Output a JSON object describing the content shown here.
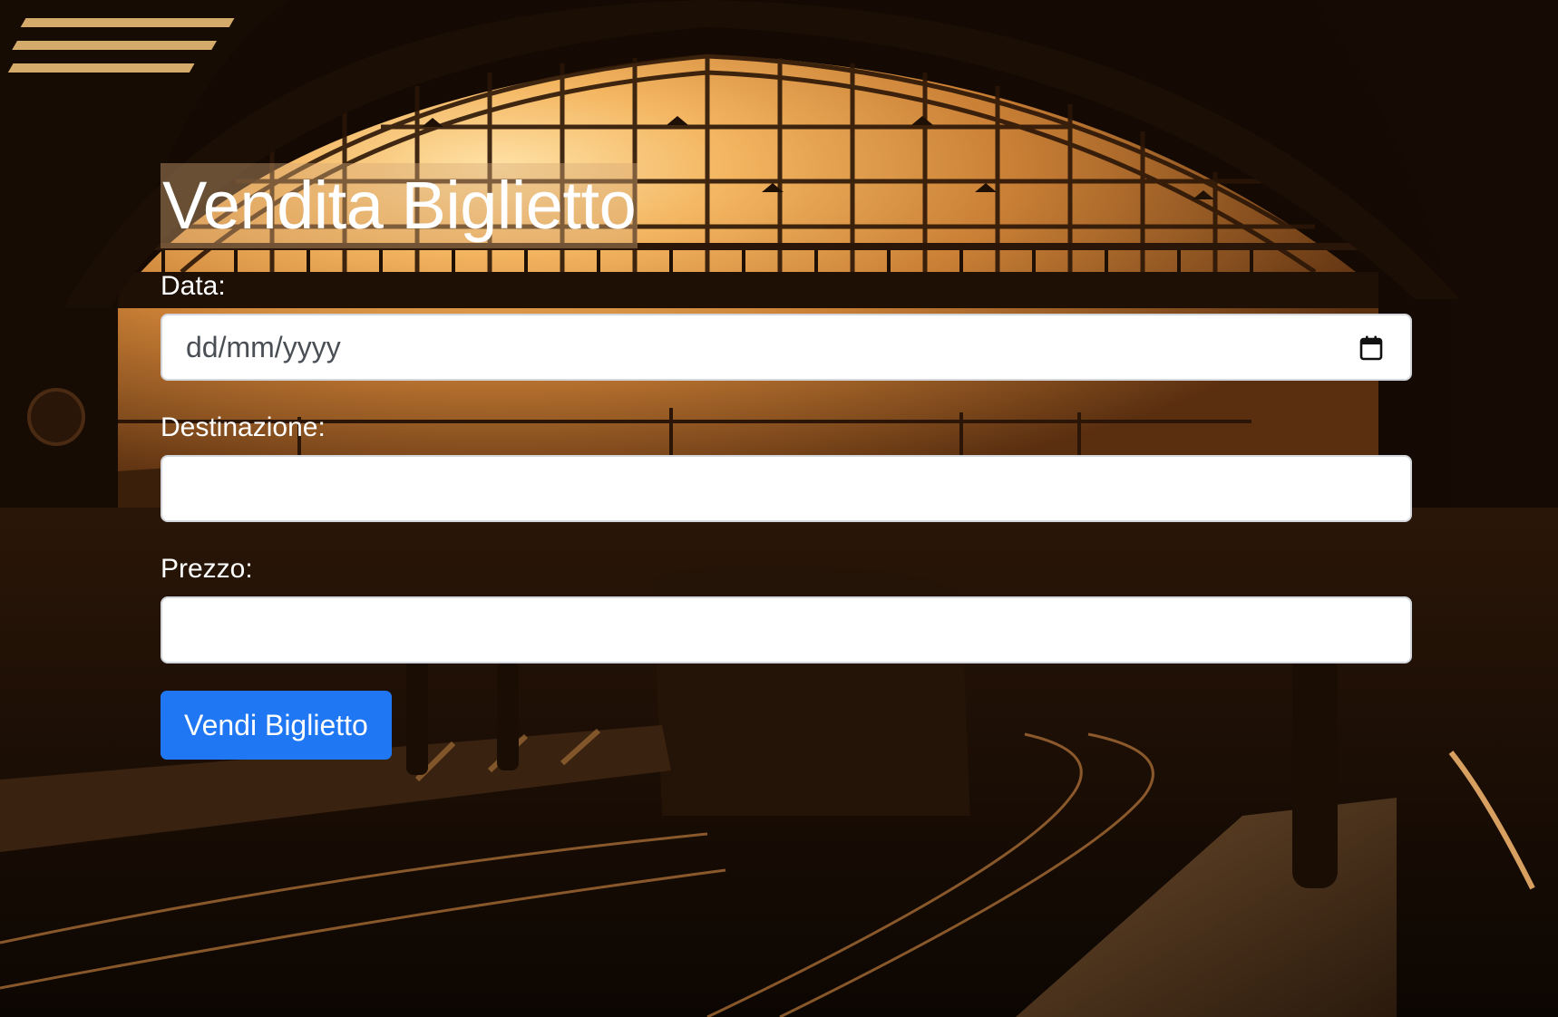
{
  "form": {
    "title": "Vendita Biglietto",
    "fields": [
      {
        "label": "Data:",
        "placeholder": "dd/mm/yyyy",
        "value": ""
      },
      {
        "label": "Destinazione:",
        "value": ""
      },
      {
        "label": "Prezzo:",
        "value": ""
      }
    ],
    "submit_label": "Vendi Biglietto"
  },
  "icons": {
    "calendar": "calendar-icon"
  },
  "colors": {
    "accent": "#1f77f3",
    "text_on_bg": "#ffffff",
    "input_bg": "#ffffff",
    "input_border": "#d3d7dc",
    "sky_glow": "#f3b560",
    "background_dark": "#140a03"
  }
}
